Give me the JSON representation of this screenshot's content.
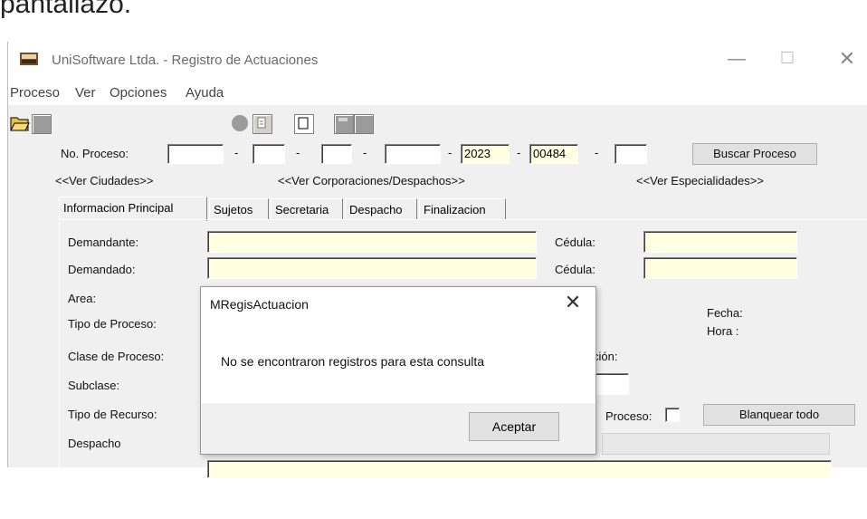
{
  "doc_text": "pantallazo.",
  "window": {
    "title": "UniSoftware Ltda. - Registro de Actuaciones",
    "min": "—",
    "max": "☐",
    "close": "✕"
  },
  "menu": [
    "Proceso",
    "Ver",
    "Opciones",
    "Ayuda"
  ],
  "proceso": {
    "label": "No. Proceso:",
    "sep": "-",
    "year": "2023",
    "number": "00484",
    "search_button": "Buscar Proceso"
  },
  "links": {
    "ciudades": "<<Ver Ciudades>>",
    "corporaciones": "<<Ver Corporaciones/Despachos>>",
    "especialidades": "<<Ver Especialidades>>"
  },
  "tabs": [
    "Informacion Principal",
    "Sujetos",
    "Secretaria",
    "Despacho",
    "Finalizacion"
  ],
  "form": {
    "demandante": "Demandante:",
    "demandado": "Demandado:",
    "cedula": "Cédula:",
    "area": "Area:",
    "tipo_proceso": "Tipo de Proceso:",
    "clase_proceso": "Clase de Proceso:",
    "subclase": "Subclase:",
    "tipo_recurso": "Tipo de Recurso:",
    "despacho": "Despacho",
    "fecha": "Fecha:",
    "hora": "Hora :",
    "cion": "ción:",
    "proceso_chk": "Proceso:",
    "blanquear": "Blanquear todo"
  },
  "dialog": {
    "title": "MRegisActuacion",
    "close": "✕",
    "message": "No se encontraron registros para esta consulta",
    "ok": "Aceptar"
  },
  "colors": {
    "yellow_field": "#ffffe1",
    "window_bg": "#f0f0f0"
  }
}
